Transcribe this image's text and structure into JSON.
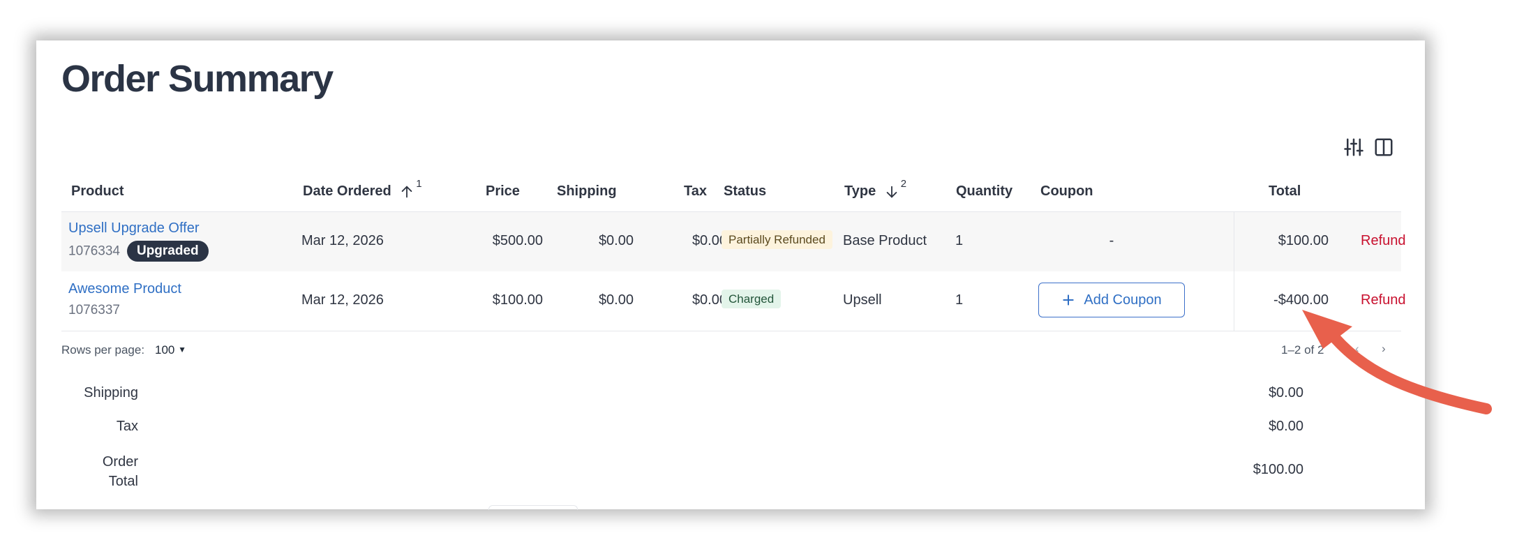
{
  "page": {
    "title": "Order Summary"
  },
  "toolbar": {
    "filter_icon": "sliders-icon",
    "columns_icon": "columns-icon"
  },
  "table": {
    "headers": {
      "product": "Product",
      "date_ordered": "Date Ordered",
      "date_sort_rank": "1",
      "price": "Price",
      "shipping": "Shipping",
      "tax": "Tax",
      "status": "Status",
      "type": "Type",
      "type_sort_rank": "2",
      "quantity": "Quantity",
      "coupon": "Coupon",
      "total": "Total"
    },
    "rows": [
      {
        "product": "Upsell Upgrade Offer",
        "product_id": "1076334",
        "tag": "Upgraded",
        "date": "Mar 12, 2026",
        "price": "$500.00",
        "shipping": "$0.00",
        "tax": "$0.00",
        "status": "Partially Refunded",
        "type": "Base Product",
        "quantity": "1",
        "coupon": "-",
        "total": "$100.00",
        "action": "Refund"
      },
      {
        "product": "Awesome Product",
        "product_id": "1076337",
        "date": "Mar 12, 2026",
        "price": "$100.00",
        "shipping": "$0.00",
        "tax": "$0.00",
        "status": "Charged",
        "type": "Upsell",
        "quantity": "1",
        "coupon_button": "Add Coupon",
        "total": "-$400.00",
        "action": "Refund"
      }
    ]
  },
  "pagination": {
    "rows_per_page_label": "Rows per page:",
    "rows_per_page_value": "100",
    "range": "1–2 of 2"
  },
  "summary": {
    "shipping_label": "Shipping",
    "shipping_value": "$0.00",
    "tax_label": "Tax",
    "tax_value": "$0.00",
    "order_total_label_1": "Order",
    "order_total_label_2": "Total",
    "order_total_value": "$100.00"
  },
  "colors": {
    "link": "#2f6fc4",
    "refund": "#c8102e",
    "annotation_arrow": "#e8604c",
    "heading": "#2b3445"
  }
}
